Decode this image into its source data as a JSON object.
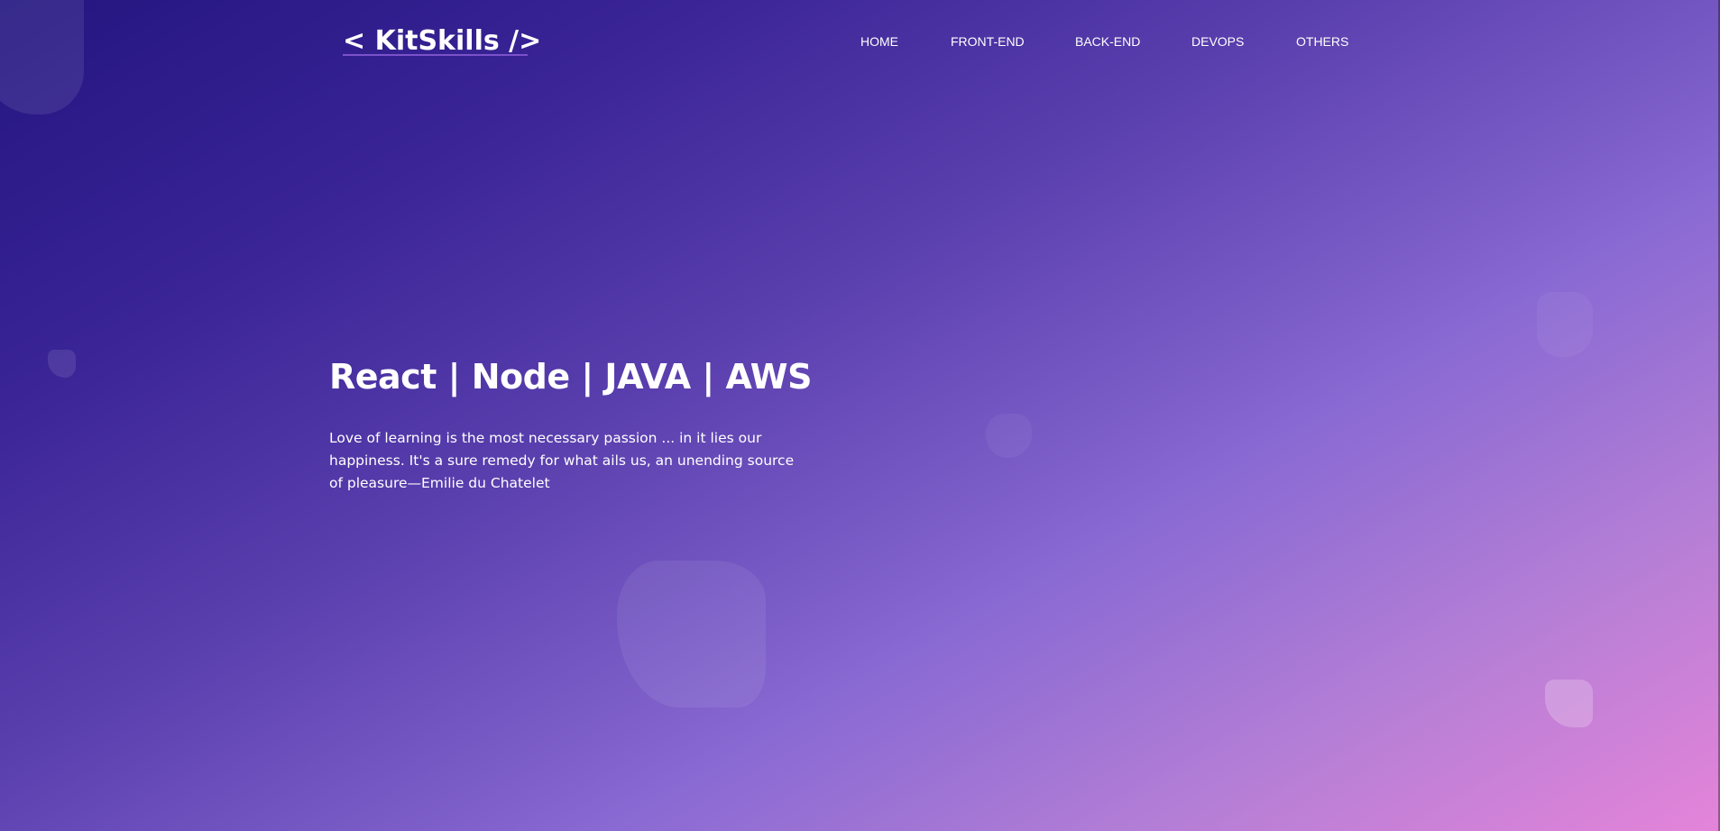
{
  "header": {
    "brand": "< KitSkills />",
    "nav": [
      {
        "label": "HOME"
      },
      {
        "label": "FRONT-END"
      },
      {
        "label": "BACK-END"
      },
      {
        "label": "DEVOPS"
      },
      {
        "label": "OTHERS"
      }
    ]
  },
  "hero": {
    "headline": "React | Node | JAVA | AWS",
    "quote": "Love of learning is the most necessary passion ... in it lies our happiness. It's a sure remedy for what ails us, an unending source of pleasure—Emilie du Chatelet"
  },
  "colors": {
    "gradient_start": "#231580",
    "gradient_mid": "#8a6ad3",
    "gradient_end": "#e484d9",
    "text": "#ffffff",
    "brand_underline": "#7c52c9"
  }
}
